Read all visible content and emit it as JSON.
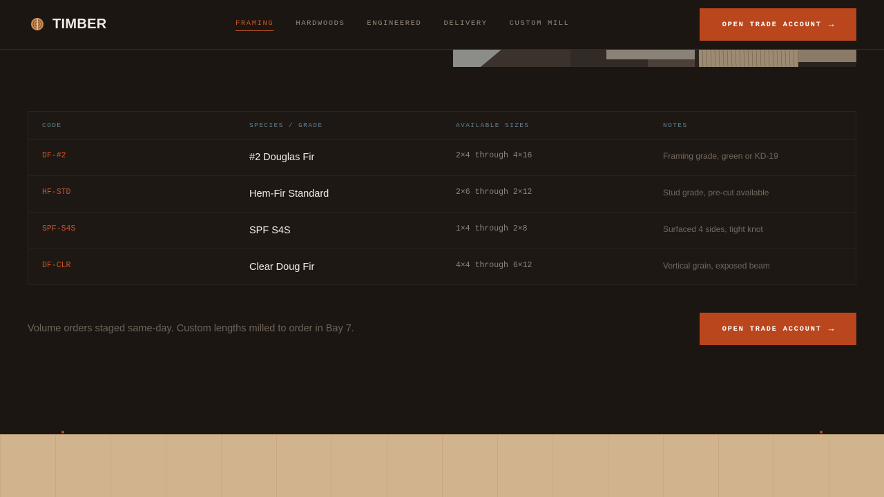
{
  "brand": {
    "name": "TIMBER",
    "logo_icon": "log-cross-section-icon"
  },
  "nav": {
    "items": [
      {
        "label": "FRAMING",
        "active": true
      },
      {
        "label": "HARDWOODS",
        "active": false
      },
      {
        "label": "ENGINEERED",
        "active": false
      },
      {
        "label": "DELIVERY",
        "active": false
      },
      {
        "label": "CUSTOM MILL",
        "active": false
      }
    ]
  },
  "cta": {
    "label": "OPEN TRADE ACCOUNT",
    "arrow": "→"
  },
  "table": {
    "headers": [
      "CODE",
      "SPECIES / GRADE",
      "AVAILABLE SIZES",
      "NOTES"
    ],
    "rows": [
      {
        "code": "DF-#2",
        "species": "#2 Douglas Fir",
        "sizes": "2×4 through 4×16",
        "notes": "Framing grade, green or KD-19"
      },
      {
        "code": "HF-STD",
        "species": "Hem-Fir Standard",
        "sizes": "2×6 through 2×12",
        "notes": "Stud grade, pre-cut available"
      },
      {
        "code": "SPF-S4S",
        "species": "SPF S4S",
        "sizes": "1×4 through 2×8",
        "notes": "Surfaced 4 sides, tight knot"
      },
      {
        "code": "DF-CLR",
        "species": "Clear Doug Fir",
        "sizes": "4×4 through 6×12",
        "notes": "Vertical grain, exposed beam"
      }
    ]
  },
  "footnote": "Volume orders staged same-day. Custom lengths milled to order in Bay 7.",
  "colors": {
    "accent": "#b9461d",
    "background": "#1c1612",
    "wood": "#d1b48d"
  }
}
